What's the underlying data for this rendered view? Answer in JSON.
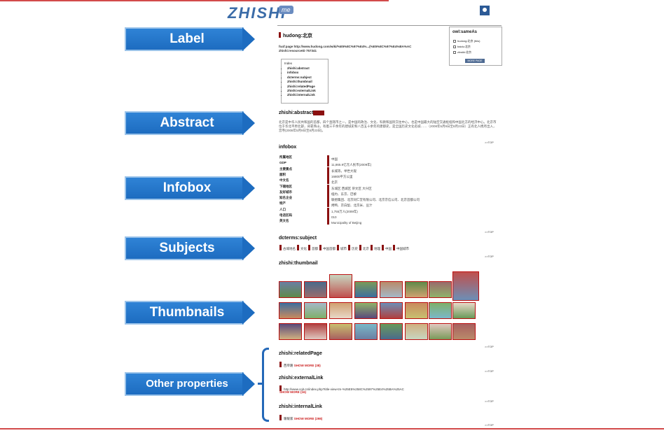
{
  "callouts": {
    "label": "Label",
    "abstract": "Abstract",
    "infobox": "Infobox",
    "subjects": "Subjects",
    "thumbnails": "Thumbnails",
    "other": "Other properties"
  },
  "colors": {
    "callout_blue": "#1d6cc0",
    "accent_red": "#8b1010",
    "rule_red": "#d24a4a"
  },
  "page": {
    "logo": "ZHISHI",
    "logo_suffix": "me",
    "label_title": "hudong:北京",
    "foaf_page": "foaf:page http://www.hudong.com/wiki/%E5%8C%97%E4%...(%E5%8C%97%E4%BA%AC",
    "resource_id": "zhishi:resourceID 757341",
    "sameas": {
      "title": "owl:sameAs",
      "items": [
        "hudong:北京 (this)",
        "baidu:北京",
        "zhwiki:北京"
      ],
      "button": "MORE PAGE"
    },
    "index": {
      "title": "Index",
      "items": [
        "zhishi:abstract",
        "infobox",
        "dcterms:subject",
        "zhishi:thumbnail",
        "zhishi:relatedPage",
        "zhishi:externalLink",
        "zhishi:internalLink"
      ]
    },
    "abstract_title": "zhishi:abstract",
    "abstract_text": "北京是中华人民共和国的首都，四个直辖市之一，是中国的政治、文化、科教和国际交往中心，也是中国最大的陆空交通枢纽和中国北方的经济中心。北京市位于华北平原北部，背靠燕山，有着三千余年的建城史和八百五十余年的建都史，是全国历史文化名城……（2008年5月9日至8月23日）正有北人携月出入，宫寺(2008年5月9日至8月23日)。",
    "totop": ">>TOP",
    "infobox_title": "infobox",
    "infobox": [
      {
        "k": "所属地区",
        "v": "中国"
      },
      {
        "k": "GDP",
        "v": "11,865.9亿元人民币(2009年)"
      },
      {
        "k": "主要景点",
        "v": "长城等，举世大观"
      },
      {
        "k": "面积",
        "v": "16800平方公里"
      },
      {
        "k": "中文名",
        "v": "北京"
      },
      {
        "k": "下辖地区",
        "v": "东城区 西城区 崇文区 大兴区"
      },
      {
        "k": "友好城市",
        "v": "纽约、东京、巴黎"
      },
      {
        "k": "知名企业",
        "v": "联想集团、北京同仁堂有限公司、北京京信公司、北京首都公司"
      },
      {
        "k": "特产",
        "v": "烤鸭、京白梨、北京米、豆汁"
      },
      {
        "k": "人口",
        "v": "1,755万人(2009年)"
      },
      {
        "k": "电话区码",
        "v": "010"
      },
      {
        "k": "英文名",
        "v": "Municipality of Beijing"
      }
    ],
    "subjects_title": "dcterms:subject",
    "subjects": [
      "古城地名",
      "文化",
      "首都",
      "中国首都",
      "城市",
      "历史",
      "北京",
      "地理",
      "中国",
      "中国城市"
    ],
    "thumbnail_title": "zhishi:thumbnail",
    "related_title": "zhishi:relatedPage",
    "related_item": "西单路",
    "related_more": "SHOW MORE (38)",
    "external_title": "zhishi:externalLink",
    "external_item": "http://www.cqit.cn/index.php?title-view-tm-%25E5%258C%2597%25E4%25BA%25AC",
    "external_more": "SHOW MORE (16)",
    "internal_title": "zhishi:internalLink",
    "internal_item": "暖暖家",
    "internal_more": "SHOW MORE (298)"
  }
}
